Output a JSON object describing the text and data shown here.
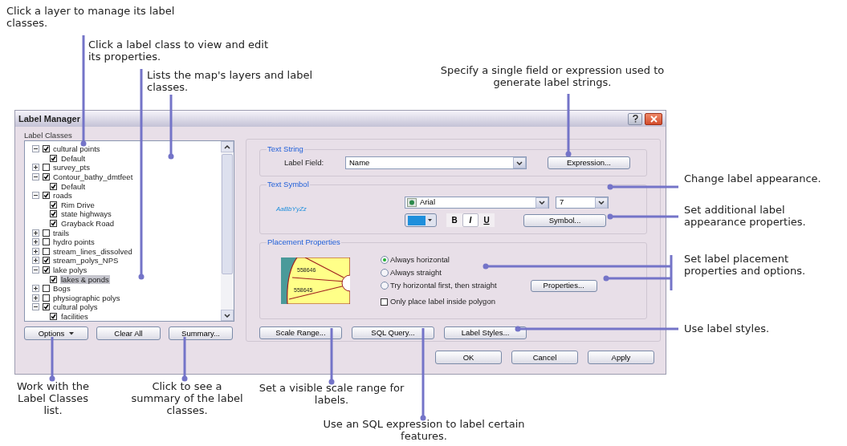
{
  "callouts": [
    {
      "text": "Click a layer to manage its label classes."
    },
    {
      "text": "Click a label class to view and edit its properties."
    },
    {
      "text": "Lists the map's layers and label classes."
    },
    {
      "text": "Specify a single field or expression used to generate label strings."
    },
    {
      "text": "Change label appearance."
    },
    {
      "text": "Set additional label appearance properties."
    },
    {
      "text": "Set label placement properties and options."
    },
    {
      "text": "Use label styles."
    },
    {
      "text": "Work with the Label Classes list."
    },
    {
      "text": "Click to see a summary of the label classes."
    },
    {
      "text": "Set a visible scale range for labels."
    },
    {
      "text": "Use an SQL expression to label certain features."
    }
  ],
  "dialog": {
    "title": "Label Manager",
    "label_classes": {
      "title": "Label Classes",
      "tree": [
        {
          "label": "cultural points",
          "checked": true,
          "expanded": true,
          "children": [
            {
              "label": "Default",
              "checked": true,
              "selected": false
            }
          ]
        },
        {
          "label": "survey_pts",
          "checked": false,
          "expanded": false
        },
        {
          "label": "Contour_bathy_dmtfeet",
          "checked": true,
          "expanded": true,
          "children": [
            {
              "label": "Default",
              "checked": true,
              "selected": false
            }
          ]
        },
        {
          "label": "roads",
          "checked": true,
          "expanded": true,
          "children": [
            {
              "label": "Rim Drive",
              "checked": true,
              "selected": false
            },
            {
              "label": "state highways",
              "checked": true,
              "selected": false
            },
            {
              "label": "Grayback Road",
              "checked": true,
              "selected": false
            }
          ]
        },
        {
          "label": "trails",
          "checked": false,
          "expanded": false
        },
        {
          "label": "hydro points",
          "checked": false,
          "expanded": false
        },
        {
          "label": "stream_lines_dissolved",
          "checked": false,
          "expanded": false
        },
        {
          "label": "stream_polys_NPS",
          "checked": true,
          "expanded": false
        },
        {
          "label": "lake polys",
          "checked": true,
          "expanded": true,
          "children": [
            {
              "label": "lakes & ponds",
              "checked": true,
              "selected": true
            }
          ]
        },
        {
          "label": "Bogs",
          "checked": false,
          "expanded": false
        },
        {
          "label": "physiographic polys",
          "checked": false,
          "expanded": false
        },
        {
          "label": "cultural polys",
          "checked": true,
          "expanded": true,
          "children": [
            {
              "label": "facilities",
              "checked": true,
              "selected": false
            }
          ]
        }
      ],
      "buttons": [
        {
          "label": "Options",
          "kind": "menu"
        },
        {
          "label": "Clear All",
          "kind": "plain"
        },
        {
          "label": "Summary...",
          "kind": "plain"
        }
      ]
    },
    "text_string": {
      "title": "Text String",
      "field_label": "Label Field:",
      "field_value": "Name",
      "button": "Expression..."
    },
    "text_symbol": {
      "title": "Text Symbol",
      "preview": "AaBbYyZz",
      "color": "#1e8fdc",
      "font": "Arial",
      "size": "7",
      "styles": [
        {
          "label": "B",
          "selected": false
        },
        {
          "label": "I",
          "selected": true
        },
        {
          "label": "U",
          "selected": false
        }
      ],
      "button": "Symbol..."
    },
    "placement": {
      "title": "Placement Properties",
      "preview_labels": [
        "558646",
        "558645"
      ],
      "options": [
        {
          "label": "Always horizontal",
          "selected": true
        },
        {
          "label": "Always straight",
          "selected": false
        },
        {
          "label": "Try horizontal first, then straight",
          "selected": false
        }
      ],
      "inside_polygon": {
        "label": "Only place label inside polygon",
        "checked": false
      },
      "button": "Properties..."
    },
    "buttons": [
      "Scale Range...",
      "SQL Query...",
      "Label Styles..."
    ],
    "footer": [
      "OK",
      "Cancel",
      "Apply"
    ]
  }
}
